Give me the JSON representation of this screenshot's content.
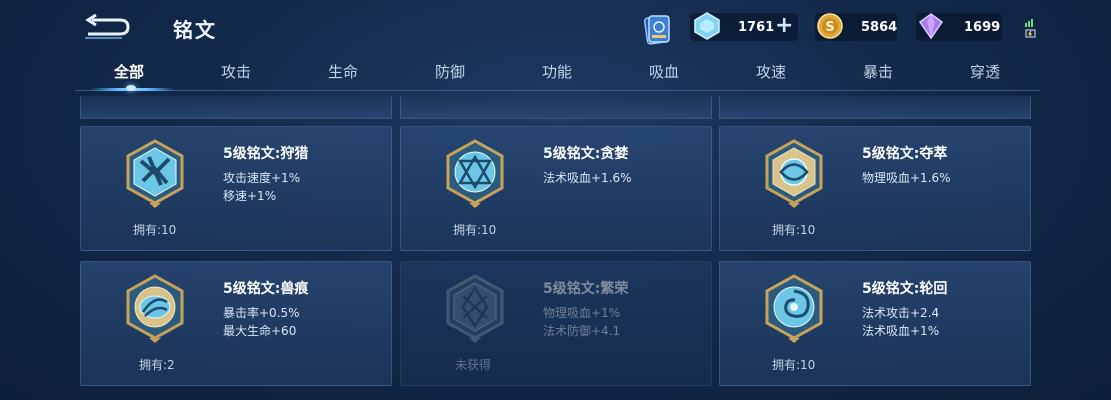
{
  "header": {
    "title": "铭文",
    "back_icon": "back-arrow-icon",
    "card_pack_icon": "card-pack-icon"
  },
  "resources": {
    "diamond": {
      "icon": "diamond-icon",
      "value": "1761",
      "add_icon": "plus-icon"
    },
    "gold": {
      "icon": "gold-coin-icon",
      "value": "5864"
    },
    "crystal": {
      "icon": "crystal-icon",
      "value": "1699"
    }
  },
  "status": {
    "icon": "battery-signal-icon"
  },
  "tabs": [
    {
      "label": "全部",
      "active": true
    },
    {
      "label": "攻击"
    },
    {
      "label": "生命"
    },
    {
      "label": "防御"
    },
    {
      "label": "功能"
    },
    {
      "label": "吸血"
    },
    {
      "label": "攻速"
    },
    {
      "label": "暴击"
    },
    {
      "label": "穿透"
    }
  ],
  "cards": [
    {
      "name": "5级铭文:狩猎",
      "stats": [
        "攻击速度+1%",
        "移速+1%"
      ],
      "own": "拥有:10",
      "emblem": "hunt-emblem-icon",
      "owned": true
    },
    {
      "name": "5级铭文:贪婪",
      "stats": [
        "法术吸血+1.6%"
      ],
      "own": "拥有:10",
      "emblem": "greed-emblem-icon",
      "owned": true
    },
    {
      "name": "5级铭文:夺萃",
      "stats": [
        "物理吸血+1.6%"
      ],
      "own": "拥有:10",
      "emblem": "plunder-emblem-icon",
      "owned": true
    },
    {
      "name": "5级铭文:兽痕",
      "stats": [
        "暴击率+0.5%",
        "最大生命+60"
      ],
      "own": "拥有:2",
      "emblem": "beast-mark-emblem-icon",
      "owned": true
    },
    {
      "name": "5级铭文:繁荣",
      "stats": [
        "物理吸血+1%",
        "法术防御+4.1"
      ],
      "own": "未获得",
      "emblem": "prosperity-emblem-icon",
      "owned": false
    },
    {
      "name": "5级铭文:轮回",
      "stats": [
        "法术攻击+2.4",
        "法术吸血+1%"
      ],
      "own": "拥有:10",
      "emblem": "reincarnation-emblem-icon",
      "owned": true
    }
  ],
  "colors": {
    "accent": "#5ab4ff",
    "gold_frame": "#c9a25a",
    "background": "#132a4b"
  }
}
